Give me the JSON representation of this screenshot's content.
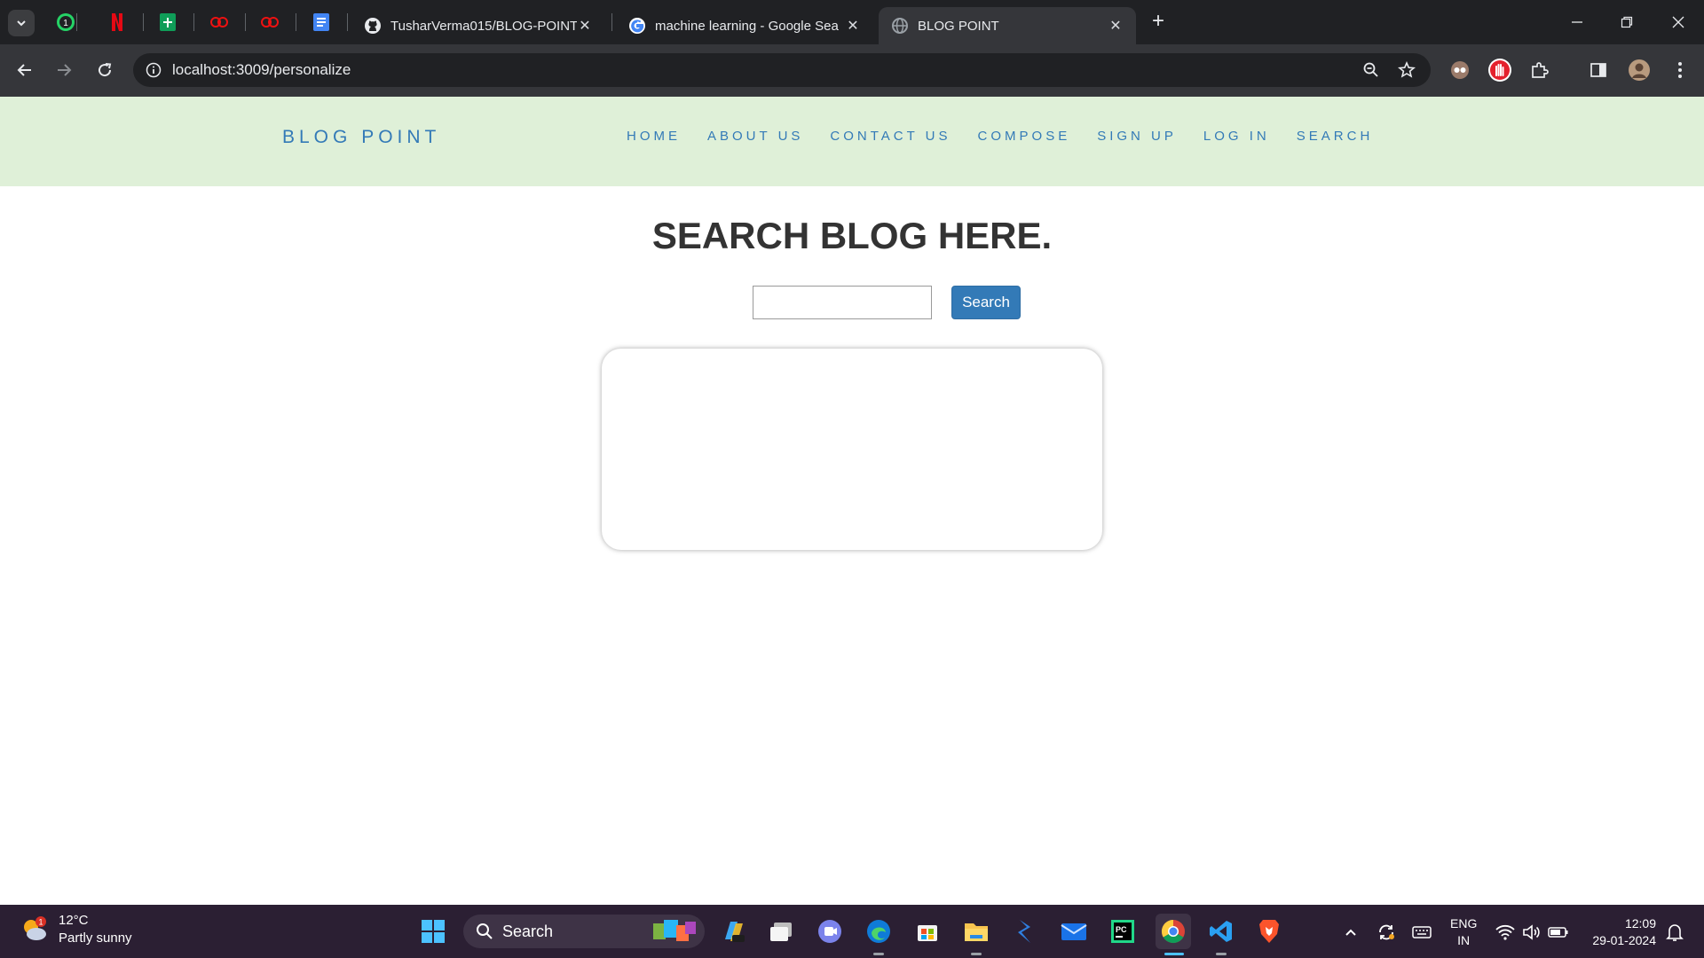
{
  "browser": {
    "tabs": [
      {
        "title": "TusharVerma015/BLOG-POINT:"
      },
      {
        "title": "machine learning - Google Sea"
      },
      {
        "title": "BLOG POINT"
      }
    ],
    "pinned_badge": "1",
    "address": "localhost:3009/personalize"
  },
  "site": {
    "brand": "BLOG POINT",
    "nav": [
      "HOME",
      "ABOUT US",
      "CONTACT US",
      "COMPOSE",
      "SIGN UP",
      "LOG IN",
      "SEARCH"
    ],
    "heading": "SEARCH BLOG HERE.",
    "search_value": "",
    "search_button": "Search",
    "colors": {
      "nav_bg": "#dff0d8",
      "link": "#337ab7",
      "button": "#337ab7"
    }
  },
  "taskbar": {
    "weather_badge": "1",
    "temperature": "12°C",
    "condition": "Partly sunny",
    "search_label": "Search",
    "lang_line1": "ENG",
    "lang_line2": "IN",
    "time": "12:09",
    "date": "29-01-2024"
  }
}
